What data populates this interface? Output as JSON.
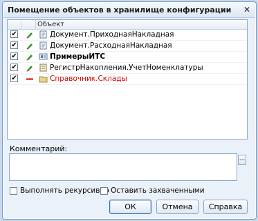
{
  "window": {
    "title": "Помещение объектов в хранилище конфигурации",
    "close_glyph": "✕"
  },
  "list": {
    "column_header": "Объект",
    "rows": [
      {
        "checked": "✔",
        "label": "Документ.ПриходнаяНакладная",
        "bold": false,
        "color": "#000000",
        "type_icon": "document-icon",
        "action_icon": "pencil-icon"
      },
      {
        "checked": "✔",
        "label": "Документ.РасходнаяНакладная",
        "bold": false,
        "color": "#000000",
        "type_icon": "document-icon",
        "action_icon": "pencil-icon"
      },
      {
        "checked": "✔",
        "label": "ПримерыИТС",
        "bold": true,
        "color": "#000000",
        "type_icon": "configuration-icon",
        "action_icon": "pencil-icon"
      },
      {
        "checked": "✔",
        "label": "РегистрНакопления.УчетНоменклатуры",
        "bold": false,
        "color": "#000000",
        "type_icon": "register-icon",
        "action_icon": "pencil-icon"
      },
      {
        "checked": "✔",
        "label": "Справочник.Склады",
        "bold": false,
        "color": "#cc0000",
        "type_icon": "folder-icon",
        "action_icon": "minus-icon"
      }
    ]
  },
  "comment": {
    "label": "Комментарий:",
    "value": "",
    "select_button": "..."
  },
  "options": {
    "recursive_label": "Выполнять рекурсивно",
    "keep_captured_label": "Оставить захваченными"
  },
  "buttons": {
    "ok": "ОК",
    "cancel": "Отмена",
    "help": "Справка"
  },
  "colors": {
    "accent_green": "#3a8f2e",
    "removed_red": "#cc0000"
  }
}
